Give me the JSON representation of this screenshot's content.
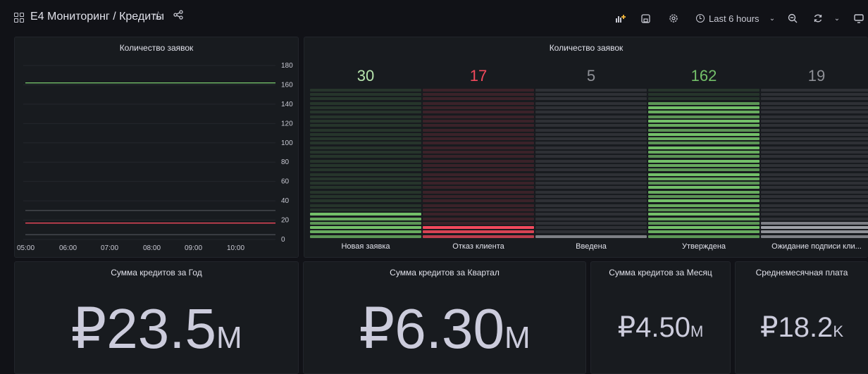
{
  "topbar": {
    "breadcrumb": "E4 Мониторинг / Кредиты",
    "time_range": "Last 6 hours",
    "icons": [
      "grid-icon",
      "star-icon",
      "share-icon",
      "add-panel-icon",
      "save-icon",
      "settings-icon",
      "clock-icon",
      "chevron-down-icon",
      "zoom-out-icon",
      "refresh-icon",
      "chevron-down-icon",
      "tv-mode-icon"
    ],
    "accent": "#f5b73b"
  },
  "panels": {
    "timeseries": {
      "title": "Количество заявок",
      "chart_data": {
        "type": "line",
        "x_ticks": [
          "05:00",
          "06:00",
          "07:00",
          "08:00",
          "09:00",
          "10:00"
        ],
        "y_ticks": [
          "180",
          "160",
          "140",
          "120",
          "100",
          "80",
          "60",
          "40",
          "20",
          "0"
        ],
        "ylim": [
          0,
          180
        ],
        "series": [
          {
            "color": "#73bf69",
            "values": [
              162,
              162,
              162,
              162,
              162,
              162
            ]
          },
          {
            "color": "#f2495c",
            "values": [
              17,
              17,
              17,
              17,
              17,
              17
            ]
          },
          {
            "color": "#5a5d63",
            "values": [
              30,
              30,
              30,
              30,
              30,
              30
            ]
          },
          {
            "color": "#5a5d63",
            "values": [
              5,
              5,
              5,
              5,
              5,
              5
            ]
          }
        ],
        "grid": true
      }
    },
    "bargauge": {
      "title": "Количество заявок",
      "chart_data": {
        "type": "bar",
        "max": 180,
        "categories": [
          "Новая заявка",
          "Отказ клиента",
          "Введена",
          "Утверждена",
          "Ожидание подписи кли..."
        ],
        "values": [
          30,
          17,
          5,
          162,
          19
        ],
        "value_labels": [
          "30",
          "17",
          "5",
          "162",
          "19"
        ],
        "colors": [
          "#73bf69",
          "#f2495c",
          "#9fa2a8",
          "#73bf69",
          "#9fa2a8"
        ],
        "label_colors": [
          "#b7e4ad",
          "#f2495c",
          "#8e9096",
          "#73bf69",
          "#8e9096"
        ]
      }
    },
    "year": {
      "title": "Сумма кредитов за Год",
      "value": "₽23.5",
      "unit": "M"
    },
    "quarter": {
      "title": "Сумма кредитов за Квартал",
      "value": "₽6.30",
      "unit": "M"
    },
    "month": {
      "title": "Сумма кредитов за Месяц",
      "value": "₽4.50",
      "unit": "M"
    },
    "avg": {
      "title": "Среднемесячная плата",
      "value": "₽18.2",
      "unit": "K"
    }
  }
}
